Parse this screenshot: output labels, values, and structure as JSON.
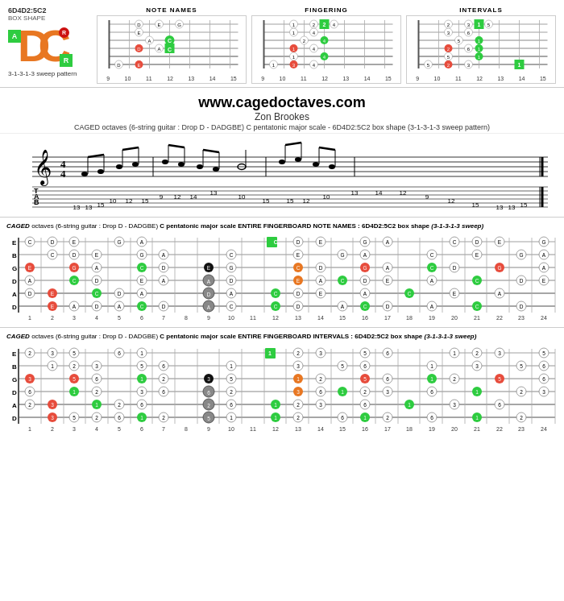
{
  "header": {
    "box_shape": "6D4D2:5C2",
    "box_shape_sub": "BOX SHAPE",
    "sweep_label": "3-1-3-1-3 sweep pattern",
    "dc_d": "D",
    "dc_c": "C",
    "note_a": "A",
    "note_r": "R"
  },
  "diagrams": [
    {
      "title": "NOTE NAMES",
      "frets": [
        "9",
        "10",
        "11",
        "12",
        "13",
        "14",
        "15"
      ]
    },
    {
      "title": "FINGERING",
      "frets": [
        "9",
        "10",
        "11",
        "12",
        "13",
        "14",
        "15"
      ]
    },
    {
      "title": "INTERVALS",
      "frets": [
        "9",
        "10",
        "11",
        "12",
        "13",
        "14",
        "15"
      ]
    }
  ],
  "website": {
    "url": "www.cagedoctaves.com",
    "author": "Zon Brookes",
    "description": "CAGED octaves (6-string guitar : Drop D - DADGBE) C pentatonic major scale - 6D4D2:5C2 box shape (3-1-3-1-3 sweep pattern)"
  },
  "fingerboard_notes": {
    "title_prefix": "CAGED octaves",
    "title_guitar": "(6-string guitar : Drop D - DADGBE)",
    "title_scale": "C pentatonic major scale ENTIRE FINGERBOARD NOTE NAMES : 6D4D2:5C2 box shape",
    "title_sweep": "(3-1-3-1-3 sweep)",
    "strings": [
      "E",
      "B",
      "G",
      "D",
      "A",
      "D"
    ],
    "fret_numbers": [
      "1",
      "2",
      "3",
      "4",
      "5",
      "6",
      "7",
      "8",
      "9",
      "10",
      "11",
      "12",
      "13",
      "14",
      "15",
      "16",
      "17",
      "18",
      "19",
      "20",
      "21",
      "22",
      "23",
      "24"
    ]
  },
  "fingerboard_intervals": {
    "title_prefix": "CAGED octaves",
    "title_guitar": "(6-string guitar : Drop D - DADGBE)",
    "title_scale": "C pentatonic major scale ENTIRE FINGERBOARD INTERVALS : 6D4D2:5C2 box shape",
    "title_sweep": "(3-1-3-1-3 sweep)",
    "strings": [
      "E",
      "B",
      "G",
      "D",
      "A",
      "D"
    ],
    "fret_numbers": [
      "1",
      "2",
      "3",
      "4",
      "5",
      "6",
      "7",
      "8",
      "9",
      "10",
      "11",
      "12",
      "13",
      "14",
      "15",
      "16",
      "17",
      "18",
      "19",
      "20",
      "21",
      "22",
      "23",
      "24"
    ]
  },
  "caged_label": "CAGED"
}
